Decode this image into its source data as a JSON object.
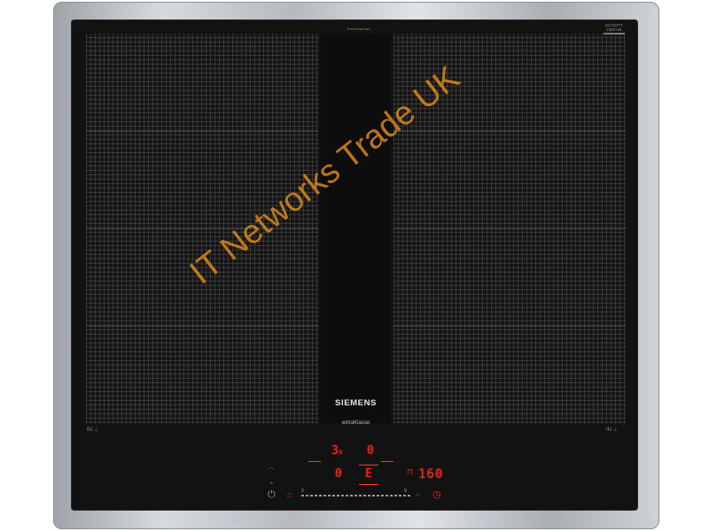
{
  "product": {
    "brand": "SIEMENS",
    "series": "extraKlasse",
    "center_top_text": "freeInduction",
    "glass_maker": "SCHOTT",
    "glass_type": "CERAN"
  },
  "zone_labels": {
    "left": "IN",
    "right": "IN"
  },
  "controls": {
    "left_power_level": "3",
    "left_power_suffix": "s",
    "right_top_value": "0",
    "center_left_value": "0",
    "center_right_value": "E",
    "timer_display": "160",
    "slider_min_label": "0",
    "slider_max_label": "9",
    "icons": [
      "wifi-icon",
      "power-icon",
      "lock-icon",
      "timer-icon",
      "clock-icon"
    ]
  },
  "watermark": {
    "text": "IT Networks Trade UK",
    "color": "#e08c19"
  }
}
